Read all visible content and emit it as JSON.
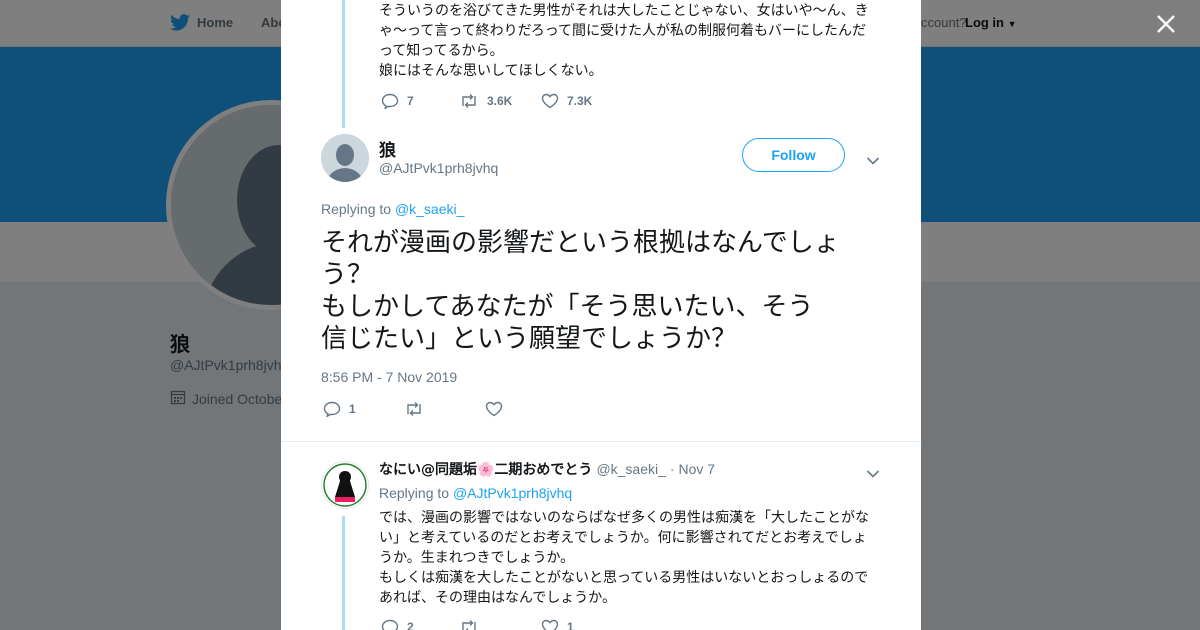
{
  "nav": {
    "home": "Home",
    "about": "Abo",
    "have_account": "ccount?",
    "login": "Log in"
  },
  "profile": {
    "name": "狼",
    "handle": "@AJtPvk1prh8jvh",
    "joined": "Joined October"
  },
  "context_tweet": {
    "text": "そういうのを浴びてきた男性がそれは大したことじゃない、女はいや～ん、き\nゃ～って言って終わりだろって間に受けた人が私の制服何着もバーにしたんだ\nって知ってるから。\n娘にはそんな思いしてほしくない。",
    "replies": "7",
    "retweets": "3.6K",
    "likes": "7.3K"
  },
  "main_tweet": {
    "author_name": "狼",
    "author_handle": "@AJtPvk1prh8jvhq",
    "follow_label": "Follow",
    "replying_prefix": "Replying to",
    "replying_to": "@k_saeki_",
    "text": "それが漫画の影響だという根拠はなんでしょ\nう？\nもしかしてあなたが「そう思いたい、そう\n信じたい」という願望でしょうか？",
    "timestamp": "8:56 PM - 7 Nov 2019",
    "replies": "1",
    "retweets": "",
    "likes": ""
  },
  "reply_tweet": {
    "author_name": "なにい@同題垢🌸二期おめでとう",
    "author_handle": "@k_saeki_",
    "date": "· Nov 7",
    "replying_prefix": "Replying to",
    "replying_to": "@AJtPvk1prh8jvhq",
    "text": "では、漫画の影響ではないのならばなぜ多くの男性は痴漢を「大したことがな\nい」と考えているのだとお考えでしょうか。何に影響されてだとお考えでしょ\nうか。生まれつきでしょうか。\nもしくは痴漢を大したことがないと思っている男性はいないとおっしょるので\nあれば、その理由はなんでしょうか。",
    "replies": "2",
    "retweets": "",
    "likes": "1"
  },
  "colors": {
    "accent": "#1da1f2",
    "thread_line": "#a9dcfc",
    "muted": "#657786",
    "banner": "#1da1f2"
  },
  "icons": [
    "twitter-bird-icon",
    "close-icon",
    "reply-icon",
    "retweet-icon",
    "like-icon",
    "chevron-down-icon",
    "calendar-icon",
    "default-avatar-icon"
  ]
}
